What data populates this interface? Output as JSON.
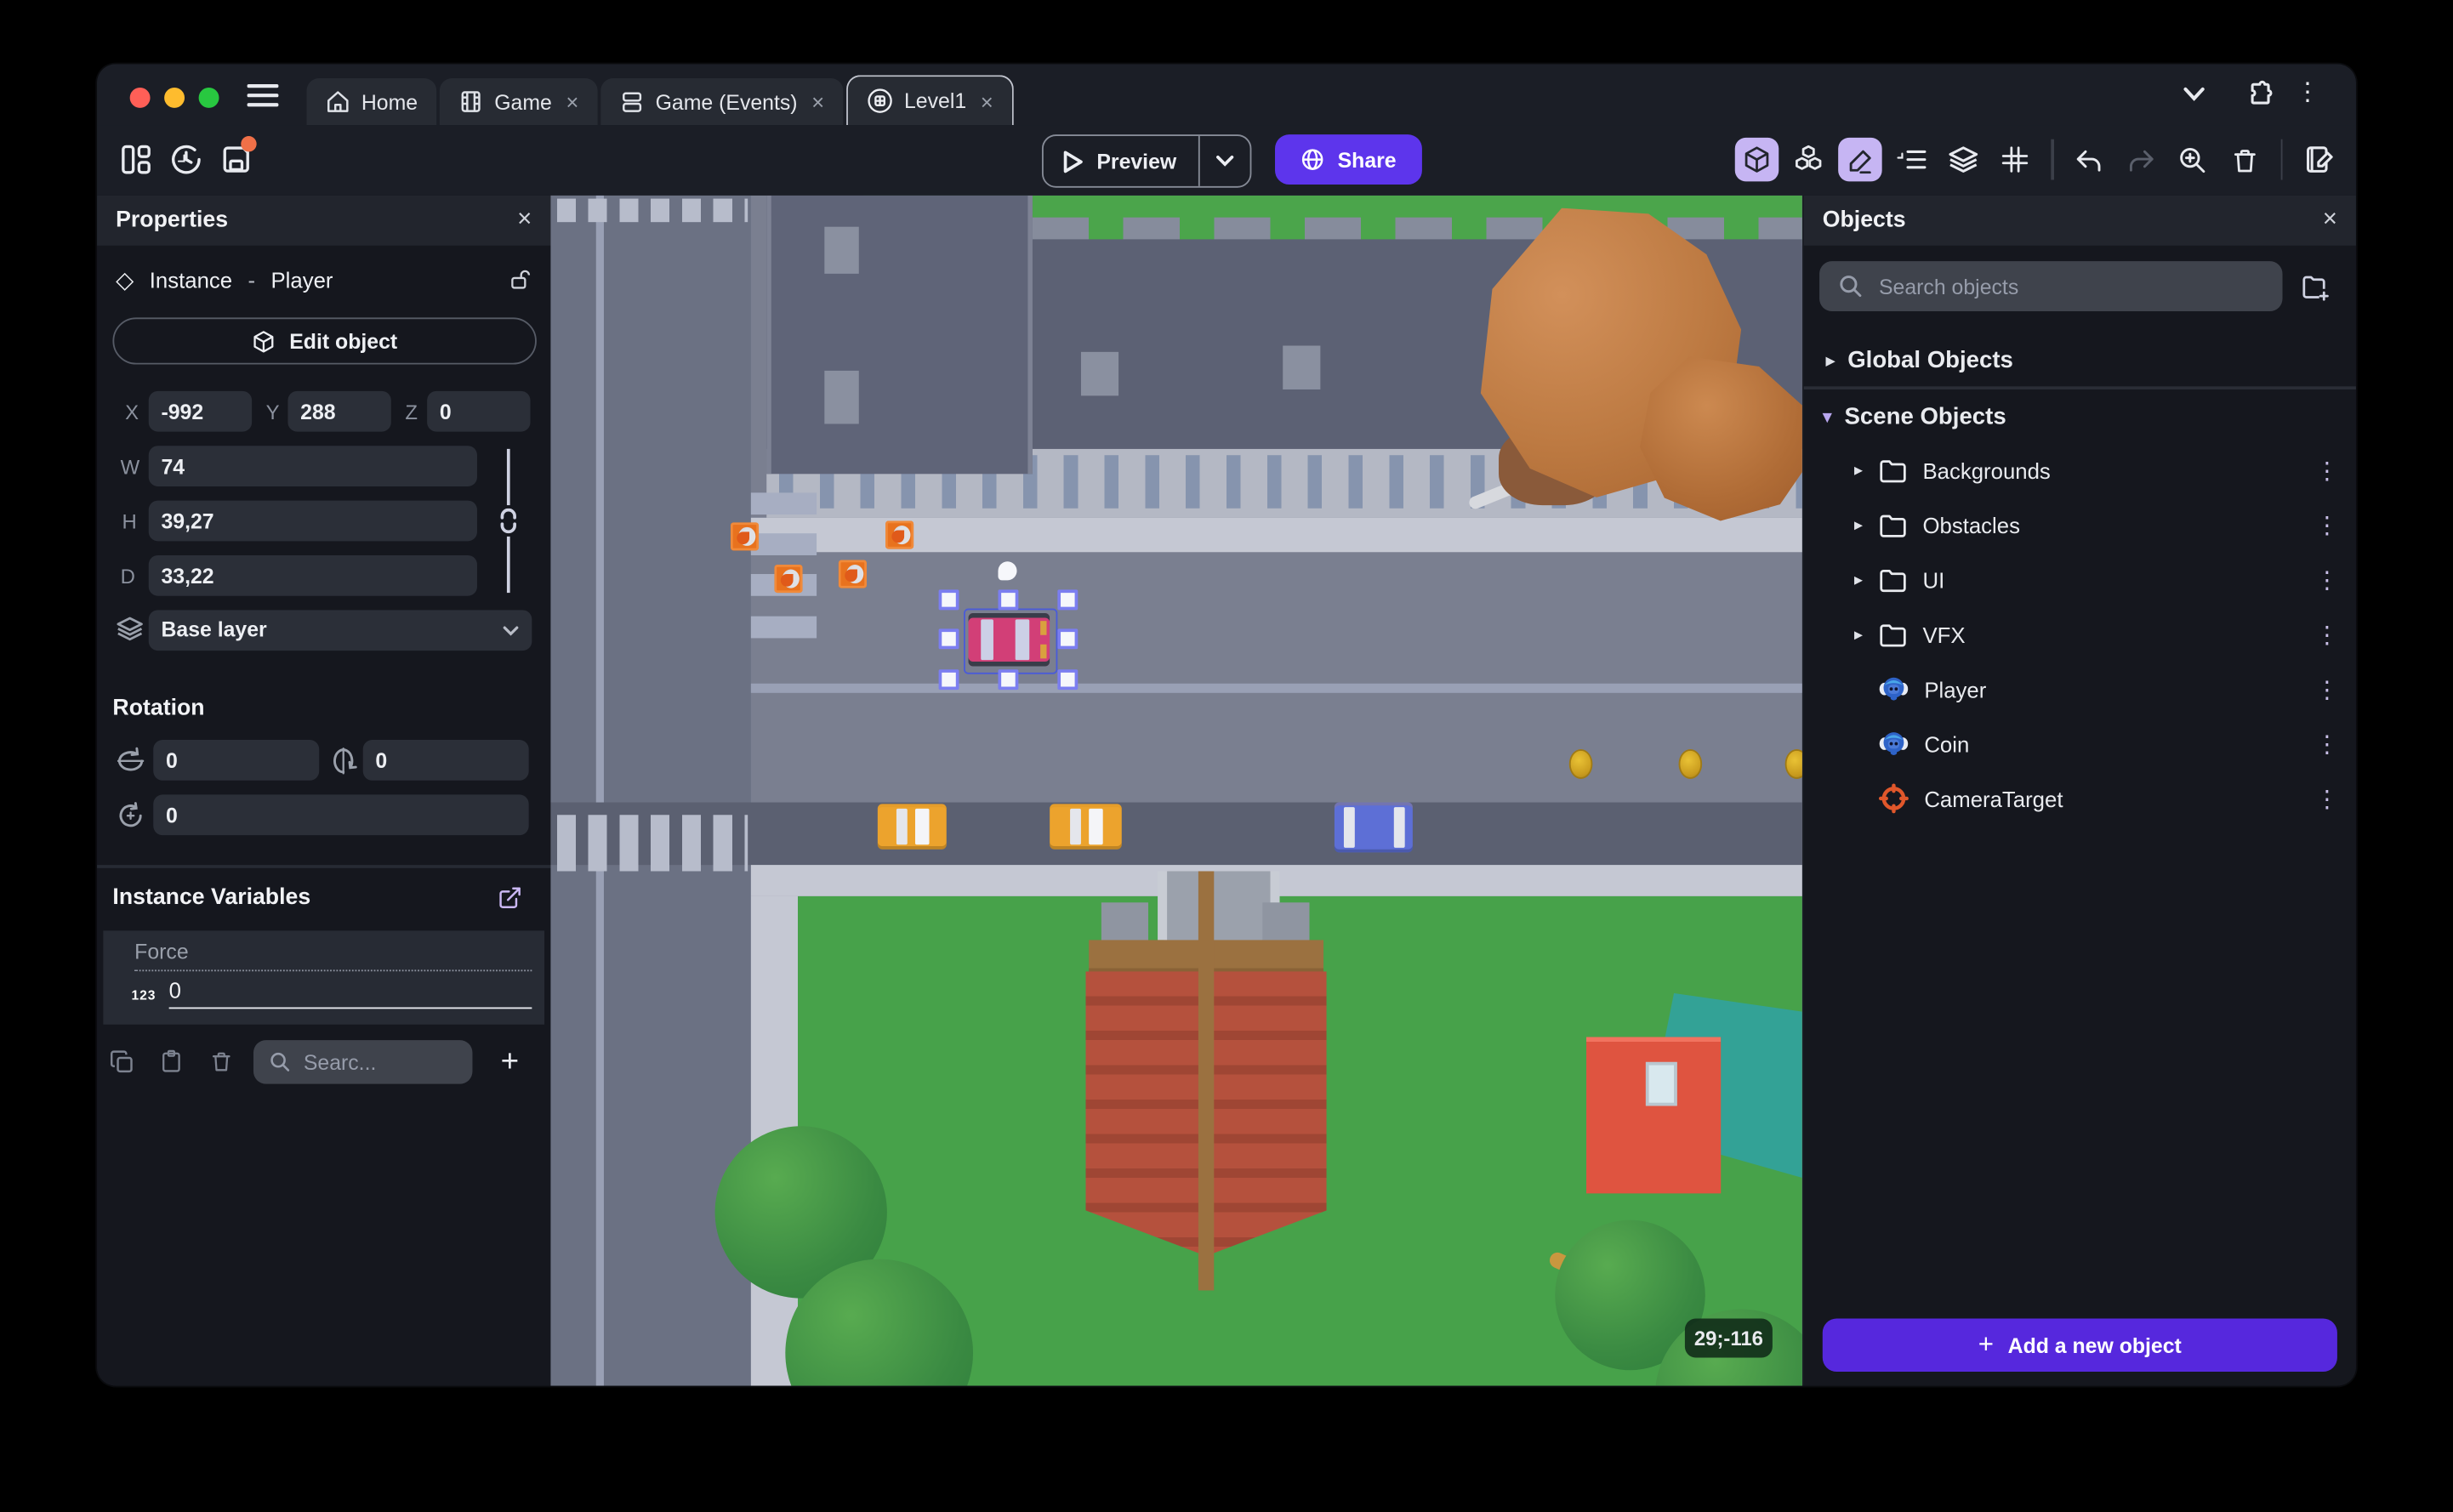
{
  "icons": {
    "close": "×",
    "kebab": "⋮",
    "chevron_right": "▸",
    "chevron_down": "▾",
    "diamond": "◇",
    "plus": "+"
  },
  "colors": {
    "traffic_red": "#ff5f57",
    "traffic_yellow": "#febc2e",
    "traffic_green": "#28c840",
    "accent_purple_share": "#5d35ec",
    "accent_purple_add": "#5628dd",
    "active_tool_bg": "#c6b5f3",
    "selection_blue": "#7b7ef0",
    "unsaved_dot": "#f07048",
    "camera_target_orange": "#e0572b"
  },
  "tab_bar": {
    "tabs": [
      {
        "label": "Home",
        "icon": "home-icon",
        "closable": false,
        "active": false
      },
      {
        "label": "Game",
        "icon": "film-icon",
        "closable": true,
        "active": false
      },
      {
        "label": "Game (Events)",
        "icon": "events-sheet-icon",
        "closable": true,
        "active": false
      },
      {
        "label": "Level1",
        "icon": "scene-icon",
        "closable": true,
        "active": true
      }
    ]
  },
  "window_controls": {
    "right_icons": [
      "chevron-down",
      "extensions-puzzle",
      "kebab-menu"
    ]
  },
  "toolbar": {
    "left_icons": [
      "project-manager",
      "version-history",
      "save"
    ],
    "save_has_unsaved_dot": true,
    "preview_label": "Preview",
    "share_label": "Share",
    "right_icons": [
      "view-3d",
      "objects",
      "edit",
      "instances-list",
      "layers",
      "grid",
      "undo",
      "redo",
      "zoom-in",
      "delete",
      "scene-properties"
    ],
    "active_right_icons": [
      "view-3d",
      "edit"
    ]
  },
  "properties_panel": {
    "title": "Properties",
    "instance": {
      "kind": "Instance",
      "separator": "-",
      "object_name": "Player"
    },
    "edit_object_label": "Edit object",
    "position": {
      "x_label": "X",
      "x": "-992",
      "y_label": "Y",
      "y": "288",
      "z_label": "Z",
      "z": "0"
    },
    "size": {
      "w_label": "W",
      "w": "74",
      "h_label": "H",
      "h": "39,27",
      "d_label": "D",
      "d": "33,22"
    },
    "layer": {
      "value": "Base layer"
    },
    "rotation": {
      "title": "Rotation",
      "x": "0",
      "y": "0",
      "z": "0"
    },
    "instance_variables": {
      "title": "Instance Variables",
      "variables": [
        {
          "name": "Force",
          "type_badge": "123",
          "value": "0"
        }
      ],
      "search_placeholder": "Searc..."
    }
  },
  "objects_panel": {
    "title": "Objects",
    "search_placeholder": "Search objects",
    "groups": [
      {
        "label": "Global Objects",
        "expanded": false
      },
      {
        "label": "Scene Objects",
        "expanded": true
      }
    ],
    "folders": [
      "Backgrounds",
      "Obstacles",
      "UI",
      "VFX"
    ],
    "objects": [
      {
        "name": "Player",
        "icon": "monkey-object-icon"
      },
      {
        "name": "Coin",
        "icon": "monkey-object-icon"
      },
      {
        "name": "CameraTarget",
        "icon": "target-icon"
      }
    ],
    "add_button_label": "Add a new object"
  },
  "canvas": {
    "cursor_coordinates": "29;-116",
    "selected_instance": "Player car (pink)"
  }
}
